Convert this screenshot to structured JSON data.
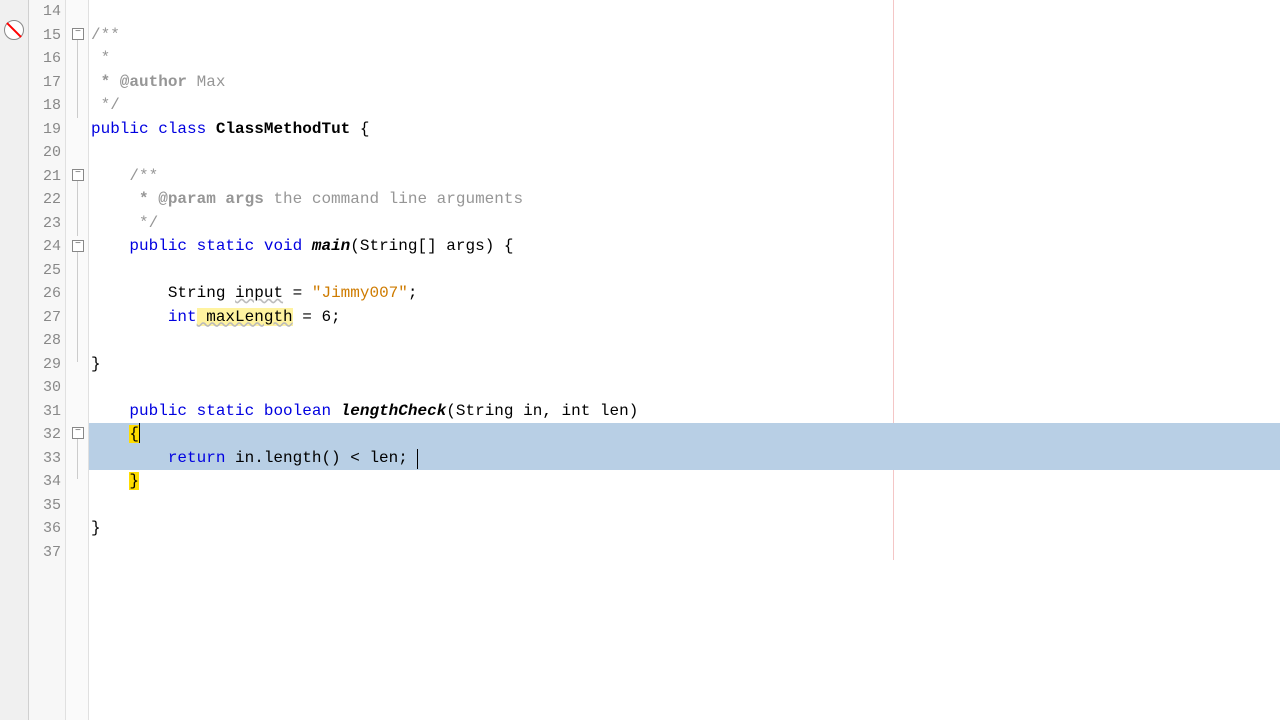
{
  "gutter": {
    "start": 14,
    "end": 37
  },
  "code": {
    "l15_comment_open": "/**",
    "l16_star": " *",
    "l17_author_tag": " * @author",
    "l17_author_name": " Max",
    "l18_comment_close": " */",
    "l19_public": "public",
    "l19_class": "class",
    "l19_classname": "ClassMethodTut",
    "l19_brace": " {",
    "l21_comment_open": "/**",
    "l22_param_tag": " * @param",
    "l22_param_name": " args",
    "l22_param_desc": " the command line arguments",
    "l23_comment_close": " */",
    "l24_public": "public",
    "l24_static": "static",
    "l24_void": "void",
    "l24_main": "main",
    "l24_sig": "(String[] args) {",
    "l26_string": "String ",
    "l26_input": "input",
    "l26_eq": " = ",
    "l26_val": "\"Jimmy007\"",
    "l26_semi": ";",
    "l27_int": "int",
    "l27_name": " maxLength",
    "l27_rest": " = 6;",
    "l29_brace": "}",
    "l31_public": "public",
    "l31_static": "static",
    "l31_boolean": "boolean",
    "l31_name": "lengthCheck",
    "l31_sig": "(String in, int len)",
    "l32_brace": "{",
    "l33_return": "return",
    "l33_rest": " in.length() < len;",
    "l34_brace": "}",
    "l36_brace": "}"
  },
  "icons": {
    "fold_minus": "−"
  }
}
